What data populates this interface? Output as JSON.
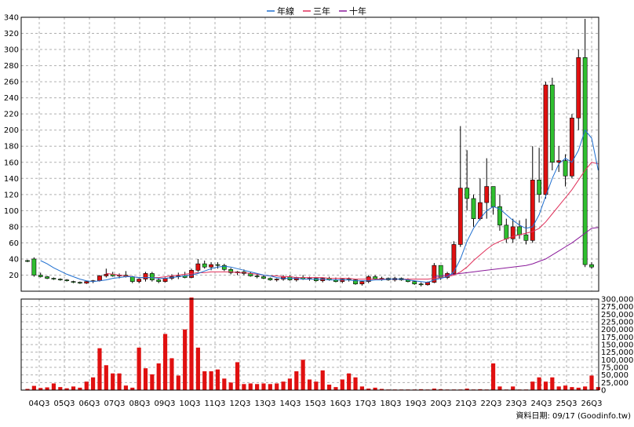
{
  "legend": [
    {
      "name": "年線",
      "color": "#1f6fd0"
    },
    {
      "name": "三年",
      "color": "#e0305a"
    },
    {
      "name": "十年",
      "color": "#8a1a9a"
    }
  ],
  "footer": "資料日期: 09/17 (Goodinfo.tw)",
  "colors": {
    "up": "#e01010",
    "down": "#2fbf2f",
    "volume": "#e01010",
    "grid": "#b0b0b0"
  },
  "chart_data": {
    "type": "candlestick",
    "price_axis": {
      "min": 0,
      "max": 340,
      "ticks": [
        20,
        40,
        60,
        80,
        100,
        120,
        140,
        160,
        180,
        200,
        220,
        240,
        260,
        280,
        300,
        320,
        340
      ]
    },
    "volume_axis": {
      "min": 0,
      "max": 300000,
      "ticks": [
        0,
        25000,
        50000,
        75000,
        100000,
        125000,
        150000,
        175000,
        200000,
        225000,
        250000,
        275000,
        300000
      ],
      "tick_labels": [
        "0",
        "25,000",
        "50,000",
        "75,000",
        "100,000",
        "125,000",
        "150,000",
        "175,000",
        "200,000",
        "225,000",
        "250,000",
        "275,000",
        "300,000"
      ]
    },
    "x_labels": [
      "04Q3",
      "05Q3",
      "06Q3",
      "07Q3",
      "08Q3",
      "09Q3",
      "10Q3",
      "11Q3",
      "12Q3",
      "13Q3",
      "14Q3",
      "15Q3",
      "16Q3",
      "17Q3",
      "18Q3",
      "19Q3",
      "20Q3",
      "21Q3",
      "22Q3",
      "23Q3",
      "24Q3",
      "25Q3",
      "26Q3"
    ],
    "ohlc": [
      [
        38,
        39,
        36,
        37
      ],
      [
        40,
        42,
        18,
        20
      ],
      [
        20,
        23,
        17,
        18
      ],
      [
        18,
        19,
        15,
        16
      ],
      [
        16,
        17,
        14,
        15
      ],
      [
        15,
        16,
        13,
        14
      ],
      [
        14,
        15,
        12,
        13
      ],
      [
        12,
        13,
        10,
        11
      ],
      [
        11,
        12,
        9,
        10
      ],
      [
        10,
        13,
        9,
        12
      ],
      [
        12,
        14,
        10,
        13
      ],
      [
        13,
        20,
        12,
        19
      ],
      [
        19,
        28,
        17,
        21
      ],
      [
        21,
        24,
        18,
        19
      ],
      [
        19,
        22,
        16,
        20
      ],
      [
        20,
        25,
        17,
        18
      ],
      [
        18,
        19,
        10,
        12
      ],
      [
        12,
        16,
        10,
        15
      ],
      [
        15,
        24,
        12,
        22
      ],
      [
        22,
        24,
        12,
        14
      ],
      [
        14,
        16,
        10,
        12
      ],
      [
        12,
        17,
        11,
        16
      ],
      [
        16,
        21,
        14,
        18
      ],
      [
        18,
        23,
        15,
        19
      ],
      [
        19,
        24,
        16,
        17
      ],
      [
        17,
        28,
        16,
        26
      ],
      [
        26,
        40,
        24,
        34
      ],
      [
        34,
        38,
        28,
        30
      ],
      [
        30,
        36,
        26,
        33
      ],
      [
        33,
        36,
        28,
        32
      ],
      [
        32,
        34,
        25,
        27
      ],
      [
        27,
        29,
        21,
        23
      ],
      [
        23,
        25,
        20,
        24
      ],
      [
        24,
        27,
        20,
        22
      ],
      [
        22,
        24,
        18,
        19
      ],
      [
        19,
        21,
        16,
        18
      ],
      [
        18,
        20,
        15,
        16
      ],
      [
        16,
        17,
        13,
        14
      ],
      [
        14,
        16,
        12,
        15
      ],
      [
        15,
        20,
        13,
        18
      ],
      [
        18,
        20,
        13,
        14
      ],
      [
        14,
        18,
        12,
        17
      ],
      [
        17,
        20,
        14,
        15
      ],
      [
        15,
        18,
        13,
        16
      ],
      [
        16,
        17,
        12,
        13
      ],
      [
        13,
        17,
        11,
        16
      ],
      [
        16,
        18,
        13,
        14
      ],
      [
        14,
        17,
        11,
        12
      ],
      [
        12,
        16,
        10,
        15
      ],
      [
        15,
        17,
        12,
        14
      ],
      [
        14,
        15,
        8,
        9
      ],
      [
        9,
        13,
        7,
        12
      ],
      [
        12,
        20,
        10,
        18
      ],
      [
        18,
        20,
        14,
        15
      ],
      [
        15,
        18,
        13,
        16
      ],
      [
        16,
        17,
        13,
        14
      ],
      [
        14,
        18,
        12,
        16
      ],
      [
        16,
        17,
        13,
        14
      ],
      [
        14,
        16,
        11,
        12
      ],
      [
        12,
        13,
        8,
        9
      ],
      [
        9,
        11,
        6,
        8
      ],
      [
        8,
        12,
        7,
        11
      ],
      [
        11,
        35,
        10,
        32
      ],
      [
        32,
        20,
        14,
        17
      ],
      [
        17,
        24,
        15,
        22
      ],
      [
        22,
        62,
        20,
        58
      ],
      [
        58,
        205,
        55,
        128
      ],
      [
        128,
        175,
        100,
        115
      ],
      [
        115,
        120,
        80,
        90
      ],
      [
        90,
        140,
        88,
        110
      ],
      [
        110,
        165,
        90,
        130
      ],
      [
        130,
        130,
        95,
        105
      ],
      [
        105,
        120,
        75,
        82
      ],
      [
        82,
        90,
        60,
        65
      ],
      [
        65,
        90,
        60,
        80
      ],
      [
        80,
        88,
        65,
        70
      ],
      [
        70,
        90,
        58,
        63
      ],
      [
        63,
        180,
        60,
        138
      ],
      [
        138,
        178,
        110,
        120
      ],
      [
        120,
        260,
        115,
        256
      ],
      [
        256,
        265,
        150,
        160
      ],
      [
        160,
        180,
        148,
        162
      ],
      [
        162,
        170,
        130,
        143
      ],
      [
        143,
        220,
        140,
        215
      ],
      [
        215,
        300,
        200,
        290
      ],
      [
        290,
        338,
        30,
        33
      ],
      [
        33,
        36,
        28,
        30
      ]
    ],
    "ma_year": [
      null,
      null,
      38,
      34,
      29,
      25,
      21,
      18,
      15,
      13,
      12,
      13,
      14,
      16,
      17,
      18,
      18,
      17,
      17,
      17,
      16,
      16,
      17,
      18,
      19,
      20,
      22,
      25,
      28,
      30,
      31,
      30,
      28,
      26,
      24,
      22,
      20,
      19,
      17,
      16,
      16,
      16,
      15,
      15,
      15,
      15,
      14,
      14,
      14,
      14,
      13,
      13,
      13,
      14,
      14,
      15,
      15,
      15,
      14,
      13,
      12,
      11,
      14,
      16,
      18,
      24,
      40,
      62,
      78,
      90,
      100,
      105,
      102,
      95,
      88,
      82,
      78,
      80,
      95,
      118,
      140,
      158,
      165,
      160,
      175,
      200,
      190,
      150
    ],
    "ma_3y": [
      null,
      null,
      null,
      null,
      null,
      null,
      null,
      null,
      null,
      null,
      null,
      null,
      22,
      21,
      20,
      19,
      18,
      17,
      17,
      17,
      17,
      18,
      19,
      20,
      21,
      22,
      23,
      23,
      24,
      24,
      24,
      24,
      23,
      23,
      22,
      21,
      20,
      19,
      19,
      18,
      18,
      17,
      17,
      17,
      17,
      17,
      16,
      16,
      16,
      16,
      15,
      15,
      15,
      15,
      15,
      15,
      15,
      15,
      15,
      15,
      15,
      15,
      16,
      17,
      18,
      20,
      24,
      30,
      38,
      45,
      52,
      58,
      62,
      65,
      68,
      70,
      72,
      74,
      78,
      86,
      96,
      106,
      116,
      126,
      138,
      150,
      160,
      158
    ],
    "ma_10y": [
      null,
      null,
      null,
      null,
      null,
      null,
      null,
      null,
      null,
      null,
      null,
      null,
      null,
      null,
      null,
      null,
      null,
      null,
      null,
      null,
      null,
      null,
      null,
      null,
      null,
      null,
      null,
      null,
      null,
      null,
      null,
      null,
      null,
      null,
      null,
      null,
      null,
      null,
      null,
      null,
      null,
      null,
      null,
      null,
      null,
      null,
      null,
      null,
      null,
      null,
      null,
      null,
      null,
      null,
      null,
      null,
      null,
      null,
      null,
      null,
      null,
      null,
      18,
      19,
      20,
      21,
      22,
      23,
      24,
      25,
      26,
      27,
      28,
      29,
      30,
      31,
      32,
      34,
      37,
      40,
      45,
      50,
      55,
      60,
      66,
      72,
      78,
      79
    ],
    "volume": [
      4000,
      14000,
      7000,
      9000,
      22000,
      10000,
      6000,
      12000,
      8000,
      28000,
      42000,
      138000,
      82000,
      55000,
      55000,
      15000,
      8000,
      140000,
      72000,
      52000,
      88000,
      185000,
      105000,
      48000,
      200000,
      305000,
      140000,
      62000,
      62000,
      68000,
      38000,
      25000,
      92000,
      20000,
      22000,
      20000,
      22000,
      20000,
      22000,
      28000,
      38000,
      62000,
      100000,
      35000,
      28000,
      65000,
      18000,
      10000,
      35000,
      55000,
      42000,
      12000,
      5000,
      8000,
      4000,
      2000,
      2000,
      1000,
      2000,
      2000,
      3000,
      1000,
      5000,
      3000,
      2000,
      2000,
      1000,
      5000,
      2000,
      3000,
      2000,
      88000,
      12000,
      2000,
      12000,
      2000,
      1000,
      28000,
      42000,
      28000,
      42000,
      12000,
      15000,
      10000,
      8000,
      12000,
      48000,
      10000
    ]
  }
}
